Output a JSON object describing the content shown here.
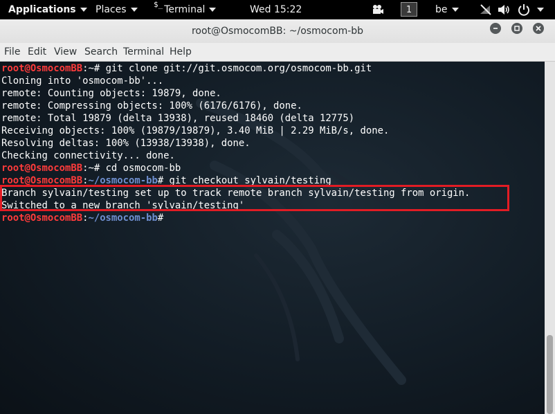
{
  "topbar": {
    "applications": "Applications",
    "places": "Places",
    "terminal_glyph": "$_",
    "terminal": "Terminal",
    "clock": "Wed 15:22",
    "workspace": "1",
    "keyboard": "be"
  },
  "window": {
    "title": "root@OsmocomBB: ~/osmocom-bb"
  },
  "menu": {
    "file": "File",
    "edit": "Edit",
    "view": "View",
    "search": "Search",
    "terminal": "Terminal",
    "help": "Help"
  },
  "terminal": {
    "prompt_user": "root@OsmocomBB",
    "lines": [
      {
        "type": "prompt",
        "sep": ":",
        "path": "~",
        "suffix": "# git clone git://git.osmocom.org/osmocom-bb.git"
      },
      {
        "type": "out",
        "text": "Cloning into 'osmocom-bb'..."
      },
      {
        "type": "out",
        "text": "remote: Counting objects: 19879, done."
      },
      {
        "type": "out",
        "text": "remote: Compressing objects: 100% (6176/6176), done."
      },
      {
        "type": "out",
        "text": "remote: Total 19879 (delta 13938), reused 18460 (delta 12775)"
      },
      {
        "type": "out",
        "text": "Receiving objects: 100% (19879/19879), 3.40 MiB | 2.29 MiB/s, done."
      },
      {
        "type": "out",
        "text": "Resolving deltas: 100% (13938/13938), done."
      },
      {
        "type": "out",
        "text": "Checking connectivity... done."
      },
      {
        "type": "prompt",
        "sep": ":",
        "path": "~",
        "suffix": "# cd osmocom-bb"
      },
      {
        "type": "prompt",
        "sep": ":",
        "path": "~/osmocom-bb",
        "suffix": "# git checkout sylvain/testing"
      },
      {
        "type": "out",
        "text": "Branch sylvain/testing set up to track remote branch sylvain/testing from origin."
      },
      {
        "type": "out",
        "text": "Switched to a new branch 'sylvain/testing'"
      },
      {
        "type": "prompt",
        "sep": ":",
        "path": "~/osmocom-bb",
        "suffix": "#"
      }
    ]
  },
  "colors": {
    "prompt_user": "#ff3b3b",
    "prompt_path": "#6f8fd0",
    "highlight_box": "#e21c24"
  }
}
